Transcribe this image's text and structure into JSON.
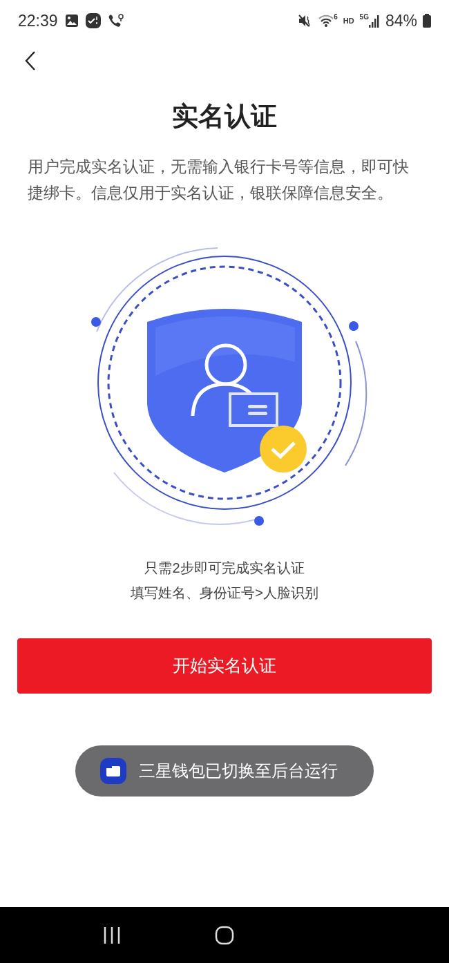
{
  "status_bar": {
    "time": "22:39",
    "wifi_badge": "6",
    "hd": "HD",
    "network": "5G",
    "battery": "84%"
  },
  "title": "实名认证",
  "intro": "用户完成实名认证，无需输入银行卡号等信息，即可快捷绑卡。信息仅用于实名认证，银联保障信息安全。",
  "steps": [
    "只需2步即可完成实名认证",
    "填写姓名、身份证号>人脸识别"
  ],
  "start_button": "开始实名认证",
  "toast": "三星钱包已切换至后台运行"
}
